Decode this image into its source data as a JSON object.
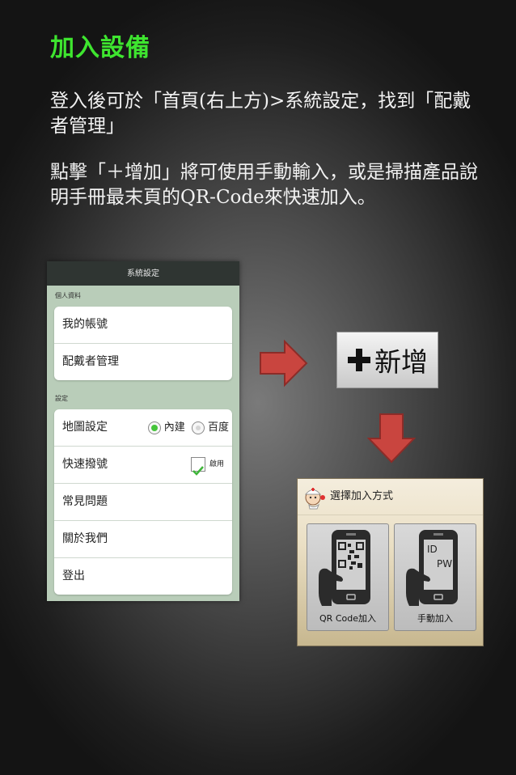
{
  "header": {
    "title": "加入設備"
  },
  "instructions": {
    "para1": "登入後可於「首頁(右上方)>系統設定，找到「配戴者管理」",
    "para2": "點擊「＋增加」將可使用手動輸入，或是掃描產品說明手冊最末頁的QR-Code來快速加入。"
  },
  "phone": {
    "title": "系統設定",
    "section_personal": "個人資料",
    "personal_items": [
      "我的帳號",
      "配戴者管理"
    ],
    "section_settings": "設定",
    "map_label": "地圖設定",
    "map_options": [
      "內建",
      "百度"
    ],
    "map_selected": "內建",
    "speed_dial_label": "快速撥號",
    "speed_dial_check": "啟用",
    "speed_dial_enabled": true,
    "other_items": [
      "常見問題",
      "關於我們",
      "登出"
    ]
  },
  "add_button": {
    "label": "新增",
    "icon": "plus-icon"
  },
  "dialog": {
    "title": "選擇加入方式",
    "options": [
      {
        "label": "QR Code加入",
        "icon": "qr-phone-icon"
      },
      {
        "label": "手動加入",
        "icon": "manual-phone-icon",
        "screen_text_1": "ID",
        "screen_text_2": "PW"
      }
    ]
  },
  "colors": {
    "title": "#3ee52f",
    "arrow": "#c9453f",
    "phone_bg": "#b9cdb9",
    "radio_on": "#45c43a"
  }
}
